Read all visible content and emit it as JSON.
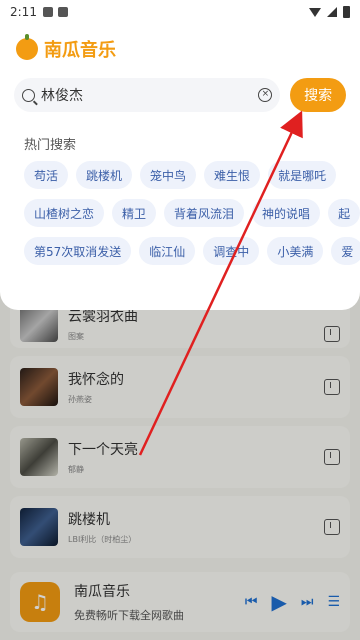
{
  "statusbar": {
    "time": "2:11"
  },
  "brand": {
    "name": "南瓜音乐"
  },
  "search": {
    "value": "林俊杰",
    "button_label": "搜索"
  },
  "hot": {
    "title": "热门搜索",
    "rows": [
      [
        "苟活",
        "跳楼机",
        "笼中鸟",
        "难生恨",
        "就是哪吒"
      ],
      [
        "山楂树之恋",
        "精卫",
        "背着风流泪",
        "神的说唱",
        "起"
      ],
      [
        "第57次取消发送",
        "临江仙",
        "调查中",
        "小美满",
        "爱"
      ]
    ]
  },
  "songs": [
    {
      "title": "云裳羽衣曲",
      "artist": "图案"
    },
    {
      "title": "我怀念的",
      "artist": "孙燕姿"
    },
    {
      "title": "下一个天亮",
      "artist": "郁静"
    },
    {
      "title": "跳楼机",
      "artist": "LBI利比（时柏尘）"
    }
  ],
  "player": {
    "title": "南瓜音乐",
    "subtitle": "免费畅听下载全网歌曲"
  },
  "colors": {
    "accent": "#f39c12",
    "annotation": "#e02020",
    "tag_text": "#3b5fa8"
  }
}
